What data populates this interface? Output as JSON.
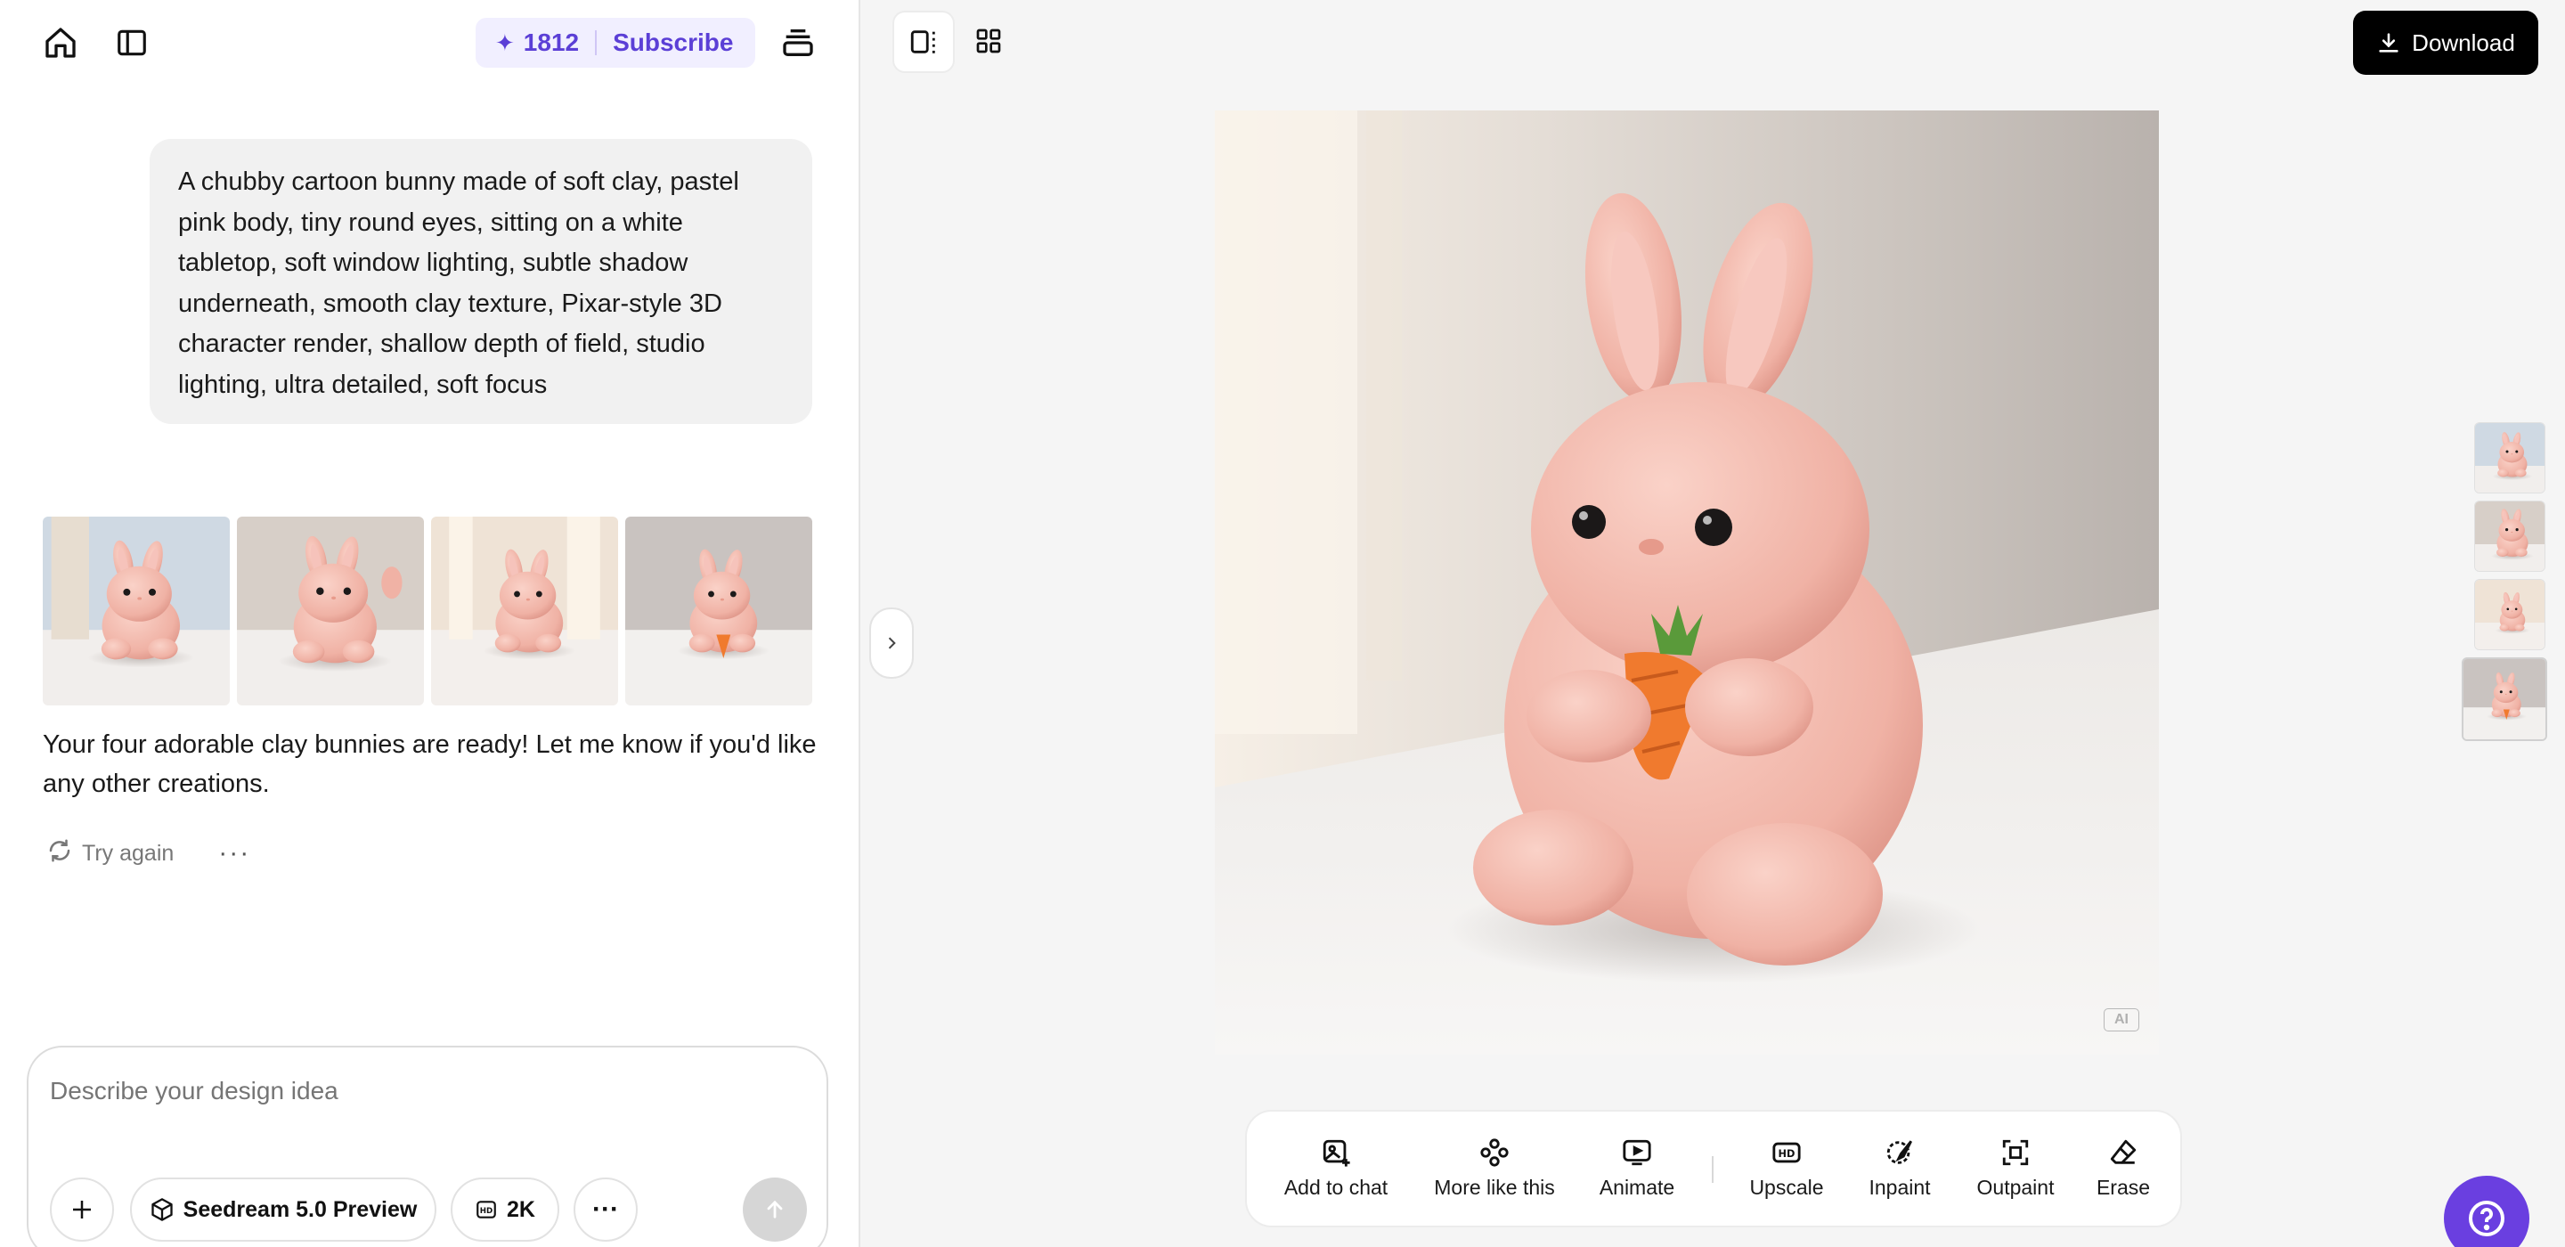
{
  "header": {
    "credits": "1812",
    "subscribe_label": "Subscribe"
  },
  "chat": {
    "prompt_text": "A chubby cartoon bunny made of soft clay, pastel pink body, tiny round eyes, sitting on a white tabletop, soft window lighting, subtle shadow underneath, smooth clay texture, Pixar-style 3D character render, shallow depth of field, studio lighting, ultra detailed, soft focus",
    "reply_text": "Your four adorable clay bunnies are ready! Let me know if you'd like any other creations.",
    "try_again_label": "Try again",
    "thumbnails": [
      "bunny-1",
      "bunny-2",
      "bunny-3",
      "bunny-4"
    ]
  },
  "composer": {
    "placeholder": "Describe your design idea",
    "model_label": "Seedream 5.0 Preview",
    "resolution_label": "2K"
  },
  "viewer": {
    "download_label": "Download",
    "ai_badge": "AI"
  },
  "toolbar": {
    "add_to_chat": "Add to chat",
    "more_like_this": "More like this",
    "animate": "Animate",
    "upscale": "Upscale",
    "inpaint": "Inpaint",
    "outpaint": "Outpaint",
    "erase": "Erase"
  },
  "colors": {
    "accent": "#5b3fd6",
    "help_button": "#6a3fe0",
    "bunny_pink": "#f2b7ab",
    "carrot": "#f07a2e"
  }
}
